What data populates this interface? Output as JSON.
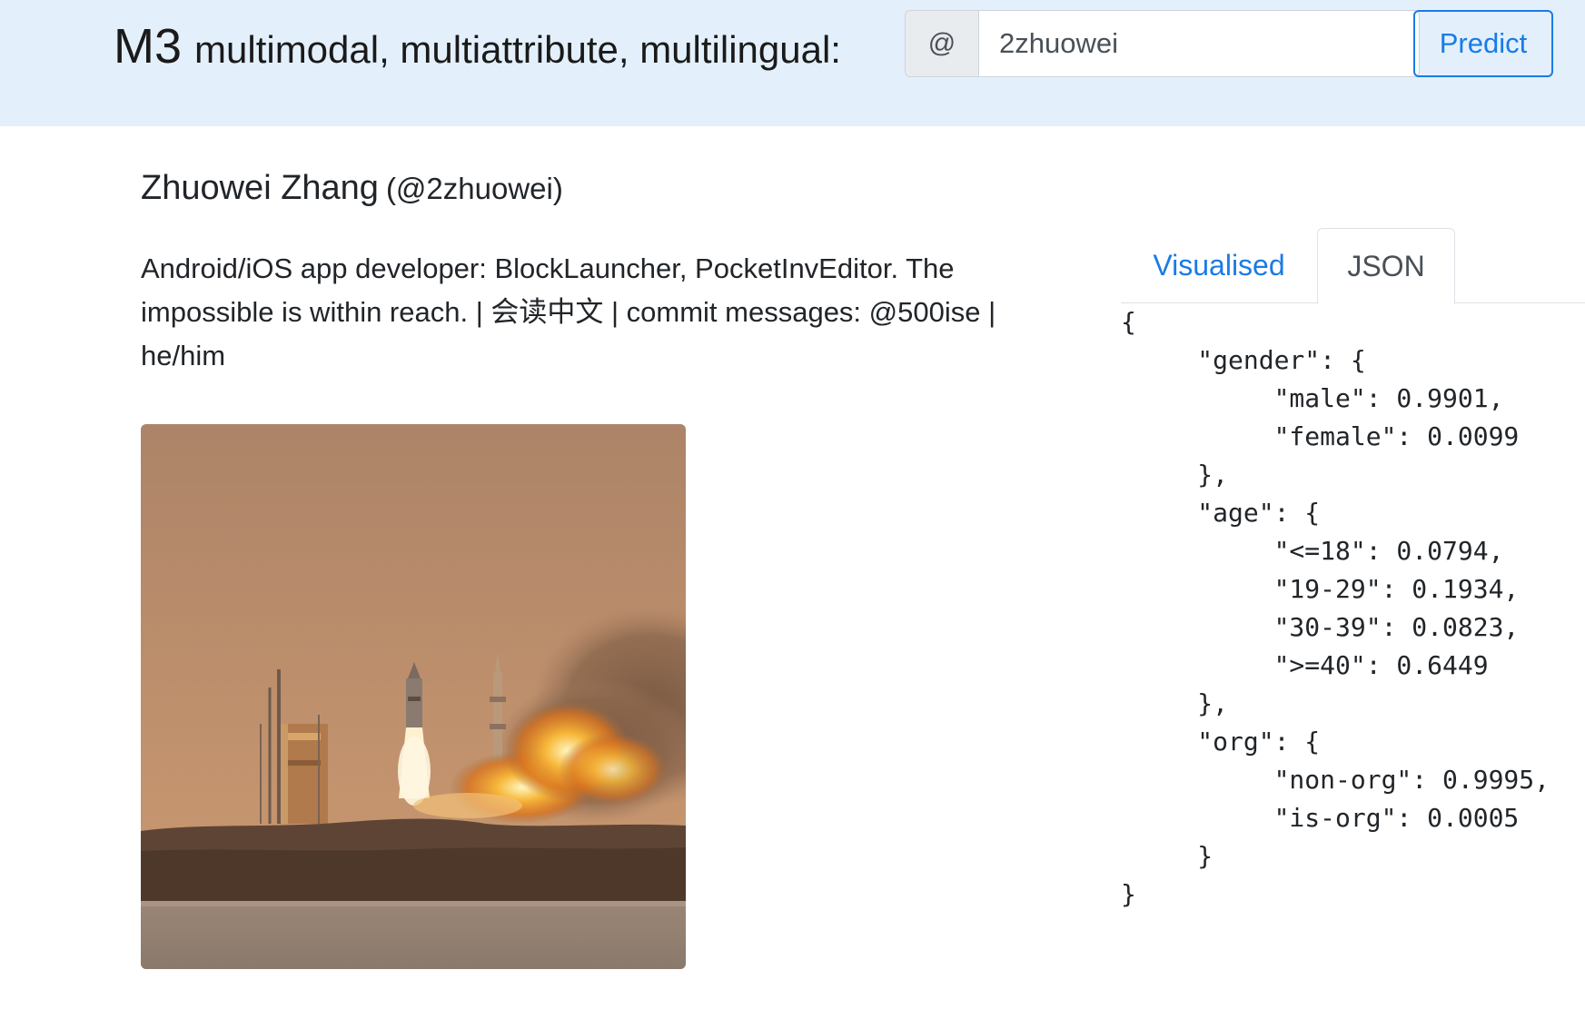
{
  "header": {
    "brand_main": "M3",
    "brand_tagline": "multimodal, multiattribute, multilingual:",
    "at_symbol": "@",
    "search_value": "2zhuowei",
    "predict_label": "Predict"
  },
  "profile": {
    "name": "Zhuowei Zhang",
    "handle": "(@2zhuowei)",
    "bio": "Android/iOS app developer: BlockLauncher, PocketInvEditor. The impossible is within reach. | 会读中文 | commit messages: @500ise | he/him",
    "avatar_icon": "rocket-launch-photo"
  },
  "tabs": {
    "visualised_label": "Visualised",
    "json_label": "JSON",
    "active": "JSON"
  },
  "json_output": "{\n     \"gender\": {\n          \"male\": 0.9901,\n          \"female\": 0.0099\n     },\n     \"age\": {\n          \"<=18\": 0.0794,\n          \"19-29\": 0.1934,\n          \"30-39\": 0.0823,\n          \">=40\": 0.6449\n     },\n     \"org\": {\n          \"non-org\": 0.9995,\n          \"is-org\": 0.0005\n     }\n}",
  "colors": {
    "header_bg": "#e3f0fb",
    "accent": "#1a7be6"
  }
}
